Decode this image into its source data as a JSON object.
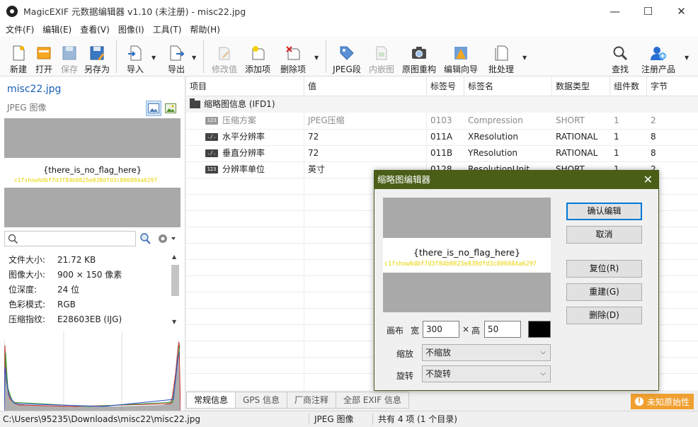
{
  "window": {
    "title": "MagicEXIF 元数据编辑器 v1.10 (未注册) - misc22.jpg",
    "minimize": "—",
    "maximize": "☐",
    "close": "✕"
  },
  "menu": [
    "文件(F)",
    "编辑(E)",
    "查看(V)",
    "图像(I)",
    "工具(T)",
    "帮助(H)"
  ],
  "toolbar": {
    "new": "新建",
    "open": "打开",
    "save": "保存",
    "save_as": "另存为",
    "import": "导入",
    "export": "导出",
    "modify_value": "修改值",
    "add_item": "添加项",
    "delete_item": "删除项",
    "jpeg_segment": "JPEG段",
    "embedded_image": "内嵌图",
    "rebuild_original": "原图重构",
    "edit_wizard": "编辑向导",
    "batch": "批处理",
    "find": "查找",
    "register": "注册产品"
  },
  "left": {
    "file_name": "misc22.jpg",
    "file_type": "JPEG 图像",
    "preview_flag": "{there_is_no_flag_here}",
    "preview_hidden": "c1fshow6dbf7d3f84b0825e838dfd3c806884a6297",
    "search_placeholder": "",
    "info": [
      {
        "key": "文件大小:",
        "value": "21.72 KB"
      },
      {
        "key": "图像大小:",
        "value": "900 × 150 像素"
      },
      {
        "key": "位深度:",
        "value": "24 位"
      },
      {
        "key": "色彩模式:",
        "value": "RGB"
      },
      {
        "key": "压缩指纹:",
        "value": "E28603EB (IJG)"
      }
    ]
  },
  "table": {
    "headers": [
      "项目",
      "值",
      "标签号",
      "标签名",
      "数据类型",
      "组件数",
      "字节"
    ],
    "group": "缩略图信息 (IFD1)",
    "rows": [
      {
        "icon": "123",
        "item": "压缩方案",
        "value": "JPEG压缩",
        "tag": "0103",
        "name": "Compression",
        "type": "SHORT",
        "count": "1",
        "bytes": "2"
      },
      {
        "icon": "./.",
        "item": "水平分辨率",
        "value": "72",
        "tag": "011A",
        "name": "XResolution",
        "type": "RATIONAL",
        "count": "1",
        "bytes": "8"
      },
      {
        "icon": "./.",
        "item": "垂直分辨率",
        "value": "72",
        "tag": "011B",
        "name": "YResolution",
        "type": "RATIONAL",
        "count": "1",
        "bytes": "8"
      },
      {
        "icon": "123",
        "item": "分辨率单位",
        "value": "英寸",
        "tag": "0128",
        "name": "ResolutionUnit",
        "type": "SHORT",
        "count": "1",
        "bytes": "2"
      }
    ]
  },
  "tabs": [
    "常规信息",
    "GPS 信息",
    "厂商注释",
    "全部 EXIF 信息"
  ],
  "badge": "未知原始性",
  "status": {
    "path": "C:\\Users\\95235\\Downloads\\misc22\\misc22.jpg",
    "type": "JPEG 图像",
    "count": "共有 4 项 (1 个目录)"
  },
  "dialog": {
    "title": "缩略图编辑器",
    "confirm": "确认编辑",
    "cancel": "取消",
    "reset": "复位(R)",
    "rebuild": "重建(G)",
    "delete": "删除(D)",
    "canvas_label": "画布",
    "width_label": "宽",
    "width_value": "300",
    "times": "×",
    "height_label": "高",
    "height_value": "50",
    "scale_label": "缩放",
    "scale_value": "不缩放",
    "rotate_label": "旋转",
    "rotate_value": "不旋转"
  },
  "colors": {
    "dialog_title_bg": "#4a5e17",
    "accent_blue": "#1a5fb4",
    "badge_orange": "#f0a030",
    "hidden_text_yellow": "#e8d400"
  }
}
